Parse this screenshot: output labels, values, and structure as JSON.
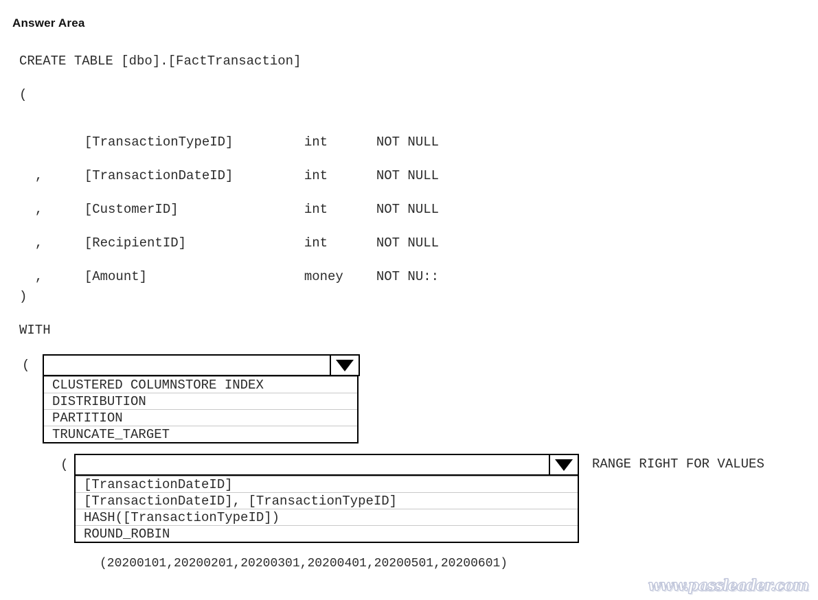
{
  "page": {
    "title": "Answer Area",
    "watermark": "www.passleader.com"
  },
  "sql": {
    "line_create": "CREATE TABLE [dbo].[FactTransaction]",
    "line_open_paren": "(",
    "line_close_paren": ")",
    "line_with": "WITH",
    "line_with_open_paren": "(",
    "line_partition_open_paren": "(",
    "columns": [
      {
        "comma": "",
        "name": "[TransactionTypeID]",
        "type": "int",
        "nullability": "NOT NULL"
      },
      {
        "comma": ",",
        "name": "[TransactionDateID]",
        "type": "int",
        "nullability": "NOT NULL"
      },
      {
        "comma": ",",
        "name": "[CustomerID]",
        "type": "int",
        "nullability": "NOT NULL"
      },
      {
        "comma": ",",
        "name": "[RecipientID]",
        "type": "int",
        "nullability": "NOT NULL"
      },
      {
        "comma": ",",
        "name": "[Amount]",
        "type": "money",
        "nullability": "NOT NU::"
      }
    ],
    "range_clause": "RANGE RIGHT FOR VALUES",
    "partition_values": "(20200101,20200201,20200301,20200401,20200501,20200601)"
  },
  "dropdowns": [
    {
      "id": "index-option",
      "selected": "",
      "arrow_icon": "chevron-down-icon",
      "options": [
        "CLUSTERED COLUMNSTORE INDEX",
        "DISTRIBUTION",
        "PARTITION",
        "TRUNCATE_TARGET"
      ]
    },
    {
      "id": "distribution-option",
      "selected": "",
      "arrow_icon": "chevron-down-icon",
      "options": [
        "[TransactionDateID]",
        "[TransactionDateID], [TransactionTypeID]",
        "HASH([TransactionTypeID])",
        "ROUND_ROBIN"
      ]
    }
  ],
  "colors": {
    "text": "#2b2b2b",
    "border": "#000000",
    "row_separator": "#c8c8c8",
    "background": "#ffffff"
  }
}
